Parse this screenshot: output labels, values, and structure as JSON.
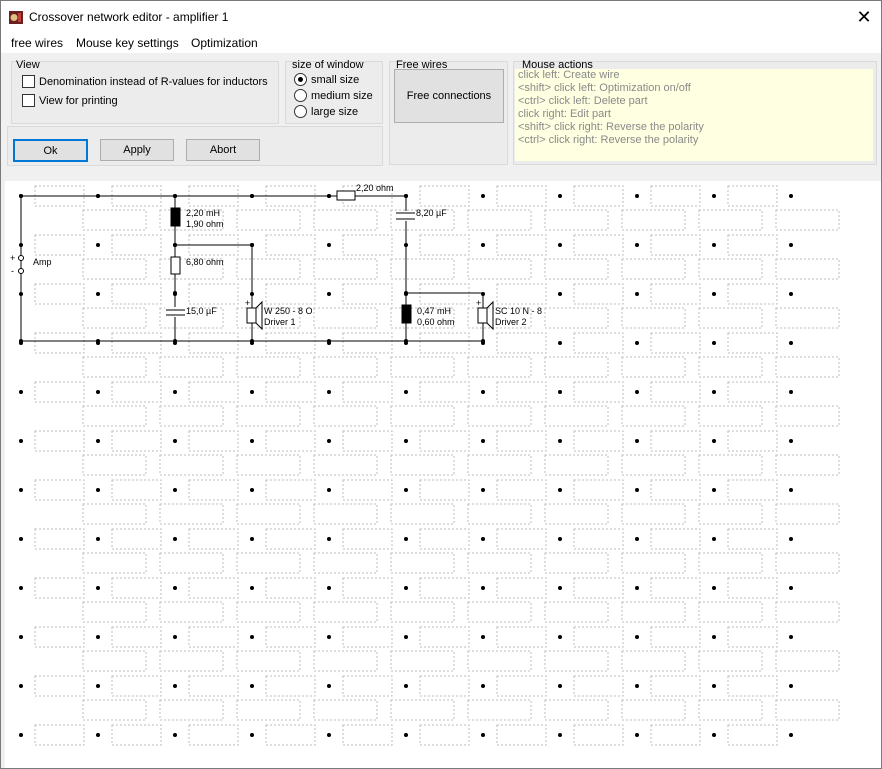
{
  "window": {
    "title": "Crossover network editor - amplifier 1"
  },
  "menu": [
    "free wires",
    "Mouse key settings",
    "Optimization"
  ],
  "view_group": {
    "label": "View",
    "denomination": "Denomination instead of R-values for inductors",
    "printing": "View for printing"
  },
  "size_group": {
    "label": "size of window",
    "small": "small size",
    "medium": "medium size",
    "large": "large size",
    "selected": "small size"
  },
  "buttons": {
    "ok": "Ok",
    "apply": "Apply",
    "abort": "Abort"
  },
  "free_wires_group": {
    "label": "Free wires",
    "button": "Free connections"
  },
  "mouse_actions": {
    "label": "Mouse actions",
    "lines": [
      "click left: Create wire",
      "<shift> click left: Optimization on/off",
      "<ctrl> click left: Delete part",
      "click right: Edit part",
      "<shift> click right: Reverse the polarity",
      "<ctrl> click right: Reverse the polarity"
    ]
  },
  "schematic": {
    "amp": "Amp",
    "amp_plus": "+",
    "amp_minus": "-",
    "r_series_top": "2,20 ohm",
    "l1": "2,20 mH",
    "l1_r": "1,90 ohm",
    "r_shunt": "6,80 ohm",
    "c_shunt": "15,0 µF",
    "driver1_name": "W 250 - 8 O",
    "driver1_label": "Driver 1",
    "c_series": "8,20 µF",
    "l2": "0,47 mH",
    "l2_r": "0,60 ohm",
    "driver2_name": "SC 10 N - 8",
    "driver2_label": "Driver 2",
    "plus": "+"
  },
  "colors": {
    "accent": "#0078d7",
    "note_bg": "#ffffe1",
    "note_text": "#8a8a8a"
  }
}
